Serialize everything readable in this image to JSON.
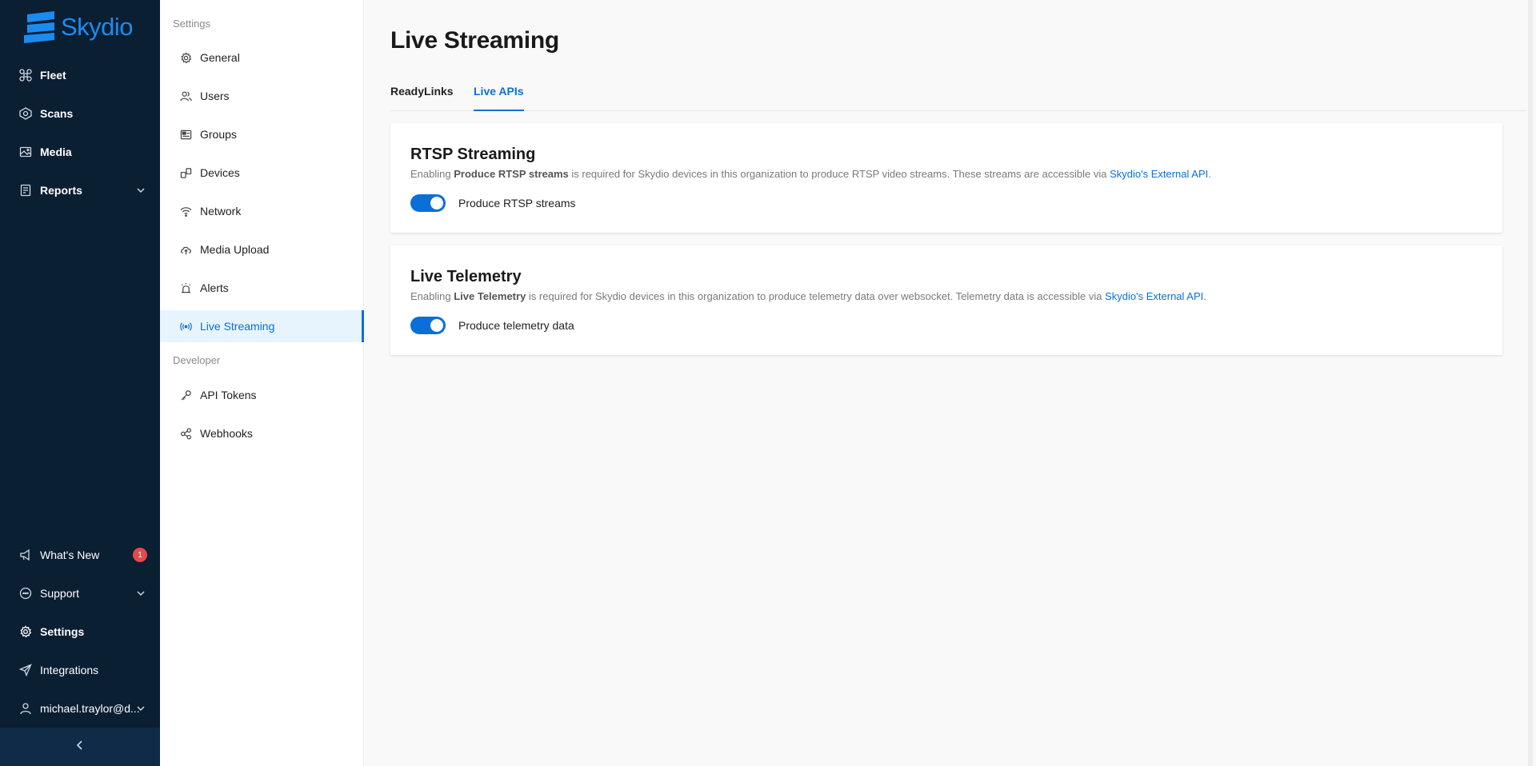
{
  "nav": {
    "brand": "Skydio",
    "items": [
      {
        "label": "Fleet",
        "icon": "drone-icon"
      },
      {
        "label": "Scans",
        "icon": "scan-icon"
      },
      {
        "label": "Media",
        "icon": "image-icon"
      },
      {
        "label": "Reports",
        "icon": "report-icon"
      }
    ],
    "bottom_items": [
      {
        "label": "What's New",
        "badge": "1"
      },
      {
        "label": "Support"
      },
      {
        "label": "Settings"
      },
      {
        "label": "Integrations"
      },
      {
        "label": "michael.traylor@d..."
      }
    ]
  },
  "settings": {
    "section_settings": "Settings",
    "items": [
      {
        "label": "General"
      },
      {
        "label": "Users"
      },
      {
        "label": "Groups"
      },
      {
        "label": "Devices"
      },
      {
        "label": "Network"
      },
      {
        "label": "Media Upload"
      },
      {
        "label": "Alerts"
      },
      {
        "label": "Live Streaming"
      }
    ],
    "section_developer": "Developer",
    "dev_items": [
      {
        "label": "API Tokens"
      },
      {
        "label": "Webhooks"
      }
    ]
  },
  "main": {
    "title": "Live Streaming",
    "tabs": [
      {
        "label": "ReadyLinks"
      },
      {
        "label": "Live APIs"
      }
    ],
    "cards": [
      {
        "title": "RTSP Streaming",
        "desc_pre": "Enabling ",
        "desc_bold": "Produce RTSP streams",
        "desc_mid": " is required for Skydio devices in this organization to produce RTSP video streams. These streams are accessible via ",
        "desc_link": "Skydio's External API",
        "desc_post": ".",
        "toggle_label": "Produce RTSP streams",
        "toggle_on": true
      },
      {
        "title": "Live Telemetry",
        "desc_pre": "Enabling ",
        "desc_bold": "Live Telemetry",
        "desc_mid": " is required for Skydio devices in this organization to produce telemetry data over websocket. Telemetry data is accessible via ",
        "desc_link": "Skydio's External API",
        "desc_post": ".",
        "toggle_label": "Produce telemetry data",
        "toggle_on": true
      }
    ]
  },
  "colors": {
    "nav_bg": "#0b1f33",
    "accent": "#0a6fd8",
    "badge": "#e5484d"
  }
}
